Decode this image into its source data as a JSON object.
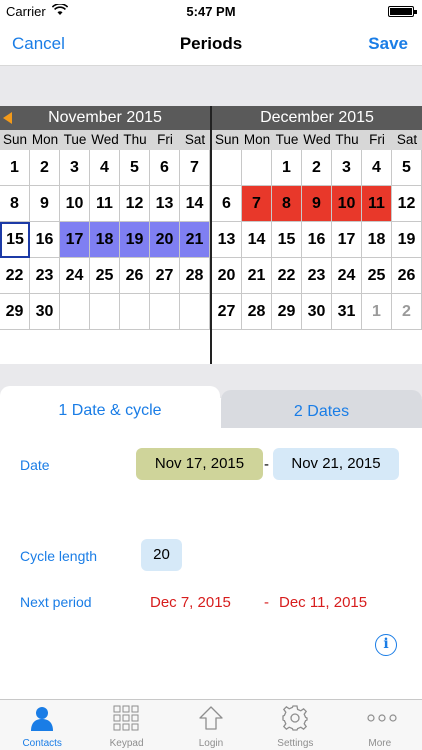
{
  "status": {
    "carrier": "Carrier",
    "time": "5:47 PM"
  },
  "nav": {
    "cancel": "Cancel",
    "title": "Periods",
    "save": "Save"
  },
  "calendar": {
    "weekdays": [
      "Sun",
      "Mon",
      "Tue",
      "Wed",
      "Thu",
      "Fri",
      "Sat"
    ],
    "months": [
      {
        "title": "November 2015",
        "weeks": [
          [
            {
              "d": "1"
            },
            {
              "d": "2"
            },
            {
              "d": "3"
            },
            {
              "d": "4"
            },
            {
              "d": "5"
            },
            {
              "d": "6"
            },
            {
              "d": "7"
            }
          ],
          [
            {
              "d": "8"
            },
            {
              "d": "9"
            },
            {
              "d": "10"
            },
            {
              "d": "11"
            },
            {
              "d": "12"
            },
            {
              "d": "13"
            },
            {
              "d": "14"
            }
          ],
          [
            {
              "d": "15",
              "s": "today"
            },
            {
              "d": "16"
            },
            {
              "d": "17",
              "s": "predicted"
            },
            {
              "d": "18",
              "s": "predicted"
            },
            {
              "d": "19",
              "s": "predicted"
            },
            {
              "d": "20",
              "s": "predicted"
            },
            {
              "d": "21",
              "s": "predicted"
            }
          ],
          [
            {
              "d": "22"
            },
            {
              "d": "23"
            },
            {
              "d": "24"
            },
            {
              "d": "25"
            },
            {
              "d": "26"
            },
            {
              "d": "27"
            },
            {
              "d": "28"
            }
          ],
          [
            {
              "d": "29"
            },
            {
              "d": "30"
            },
            {
              "d": ""
            },
            {
              "d": ""
            },
            {
              "d": ""
            },
            {
              "d": ""
            },
            {
              "d": ""
            }
          ]
        ]
      },
      {
        "title": "December 2015",
        "weeks": [
          [
            {
              "d": ""
            },
            {
              "d": ""
            },
            {
              "d": "1"
            },
            {
              "d": "2"
            },
            {
              "d": "3"
            },
            {
              "d": "4"
            },
            {
              "d": "5"
            }
          ],
          [
            {
              "d": "6"
            },
            {
              "d": "7",
              "s": "period"
            },
            {
              "d": "8",
              "s": "period"
            },
            {
              "d": "9",
              "s": "period"
            },
            {
              "d": "10",
              "s": "period"
            },
            {
              "d": "11",
              "s": "period"
            },
            {
              "d": "12"
            }
          ],
          [
            {
              "d": "13"
            },
            {
              "d": "14"
            },
            {
              "d": "15"
            },
            {
              "d": "16"
            },
            {
              "d": "17"
            },
            {
              "d": "18"
            },
            {
              "d": "19"
            }
          ],
          [
            {
              "d": "20"
            },
            {
              "d": "21"
            },
            {
              "d": "22"
            },
            {
              "d": "23"
            },
            {
              "d": "24"
            },
            {
              "d": "25"
            },
            {
              "d": "26"
            }
          ],
          [
            {
              "d": "27"
            },
            {
              "d": "28"
            },
            {
              "d": "29"
            },
            {
              "d": "30"
            },
            {
              "d": "31"
            },
            {
              "d": "1",
              "s": "gray"
            },
            {
              "d": "2",
              "s": "gray"
            }
          ]
        ]
      }
    ]
  },
  "tabs": {
    "tab1": "1 Date & cycle",
    "tab2": "2 Dates"
  },
  "form": {
    "date_label": "Date",
    "start_date": "Nov 17, 2015",
    "separator": "-",
    "end_date": "Nov 21, 2015",
    "cycle_label": "Cycle length",
    "cycle_value": "20",
    "next_label": "Next period",
    "next_start": "Dec 7, 2015",
    "next_separator": "-",
    "next_end": "Dec 11, 2015"
  },
  "tabbar": [
    {
      "label": "Contacts",
      "icon": "person-icon",
      "active": true
    },
    {
      "label": "Keypad",
      "icon": "keypad-icon",
      "active": false
    },
    {
      "label": "Login",
      "icon": "login-arrow-icon",
      "active": false
    },
    {
      "label": "Settings",
      "icon": "gear-icon",
      "active": false
    },
    {
      "label": "More",
      "icon": "more-dots-icon",
      "active": false
    }
  ],
  "colors": {
    "accent": "#1a7de6",
    "predicted": "#7f7ff2",
    "period": "#e8382a",
    "start_pill": "#cfd49a",
    "end_pill": "#d6e9f8",
    "next_text": "#d71d1d"
  }
}
